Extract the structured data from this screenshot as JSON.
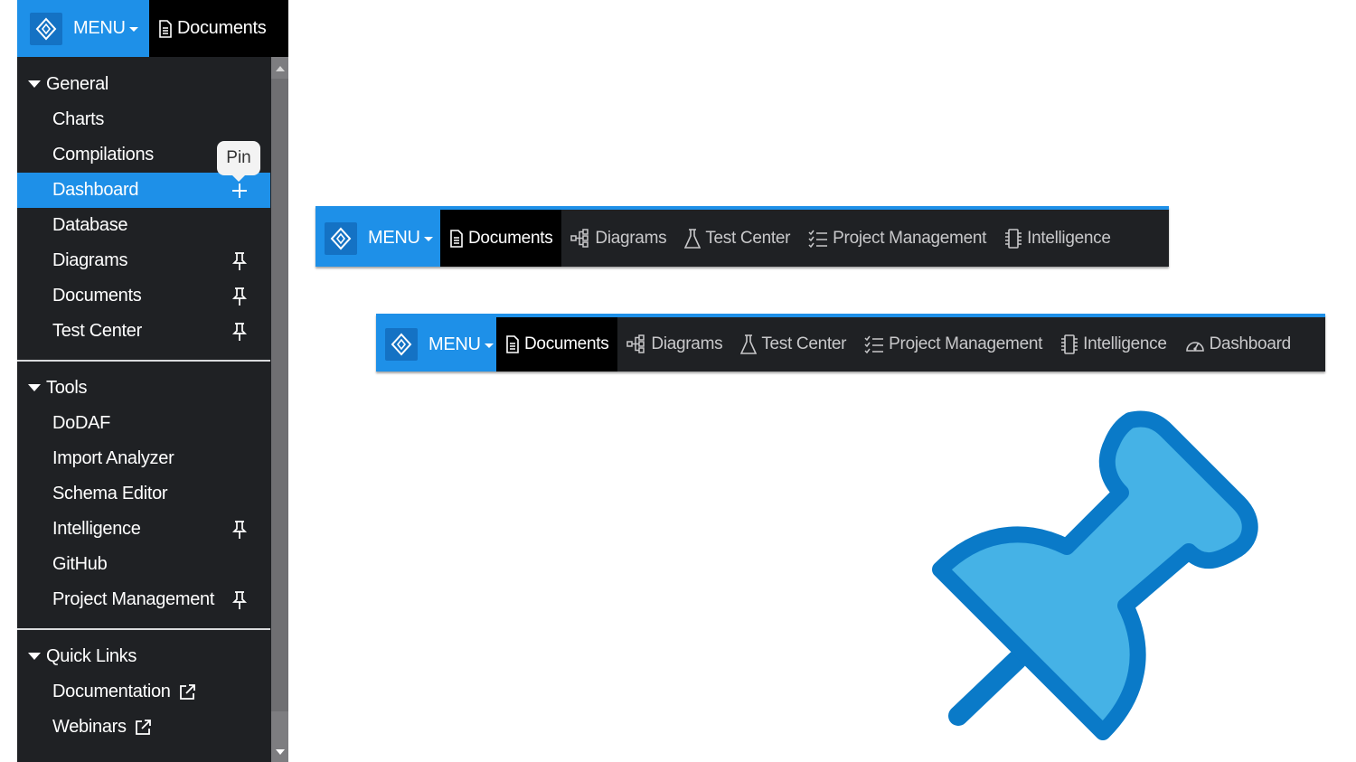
{
  "colors": {
    "accent": "#1e90e8",
    "panel": "#1f2124",
    "pin_fill": "#45b2e6",
    "pin_stroke": "#0a7ac8"
  },
  "menu": {
    "label": "MENU",
    "documents_label": "Documents"
  },
  "sidebar": {
    "tooltip": "Pin",
    "sections": [
      {
        "title": "General",
        "items": [
          "Charts",
          "Compilations",
          "Dashboard",
          "Database",
          "Diagrams",
          "Documents",
          "Test Center"
        ]
      },
      {
        "title": "Tools",
        "items": [
          "DoDAF",
          "Import Analyzer",
          "Schema Editor",
          "Intelligence",
          "GitHub",
          "Project Management"
        ]
      },
      {
        "title": "Quick Links",
        "items": [
          "Documentation",
          "Webinars"
        ]
      }
    ]
  },
  "bar1": {
    "items": [
      "Diagrams",
      "Test Center",
      "Project Management",
      "Intelligence"
    ]
  },
  "bar2": {
    "items": [
      "Diagrams",
      "Test Center",
      "Project Management",
      "Intelligence",
      "Dashboard"
    ]
  },
  "icons": [
    "logo-icon",
    "document-icon",
    "pin-icon",
    "plus-icon",
    "external-link-icon",
    "diagram-icon",
    "flask-icon",
    "checklist-icon",
    "chip-icon",
    "gauge-icon",
    "pushpin-illustration"
  ]
}
